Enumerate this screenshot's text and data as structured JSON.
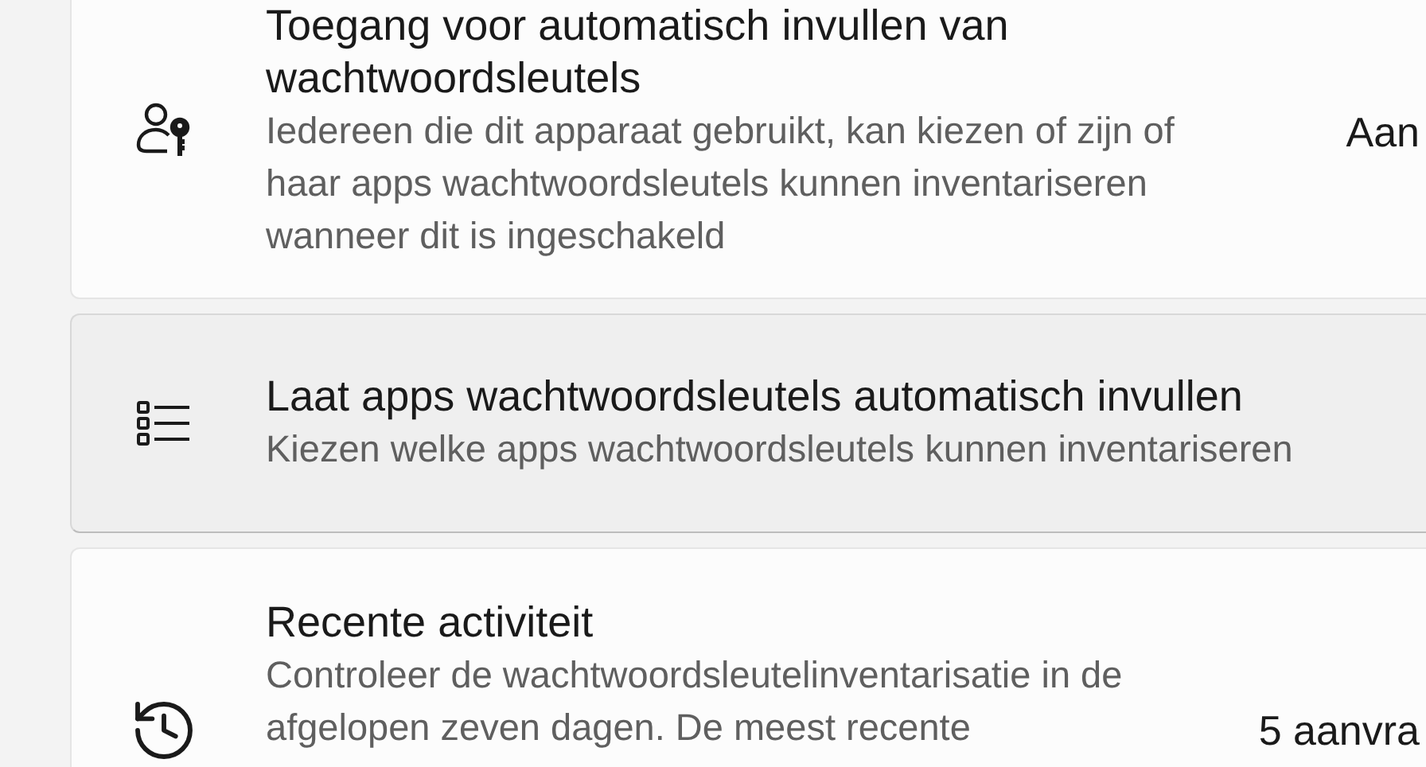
{
  "settings": [
    {
      "kind": "person-key",
      "title": "Toegang voor automatisch invullen van wachtwoordsleutels",
      "description": "Iedereen die dit apparaat gebruikt, kan kiezen of zijn of haar apps wachtwoordsleutels kunnen inventariseren wanneer dit is ingeschakeld",
      "value": "Aan",
      "hovered": false
    },
    {
      "kind": "list",
      "title": "Laat apps wachtwoordsleutels automatisch invullen",
      "description": "Kiezen welke apps wachtwoordsleutels kunnen inventariseren",
      "hovered": true
    },
    {
      "kind": "history",
      "title": "Recente activiteit",
      "description": "Controleer de wachtwoordsleutelinventarisatie in de afgelopen zeven dagen. De meest recente",
      "value": "5 aanvra",
      "hovered": false
    }
  ]
}
